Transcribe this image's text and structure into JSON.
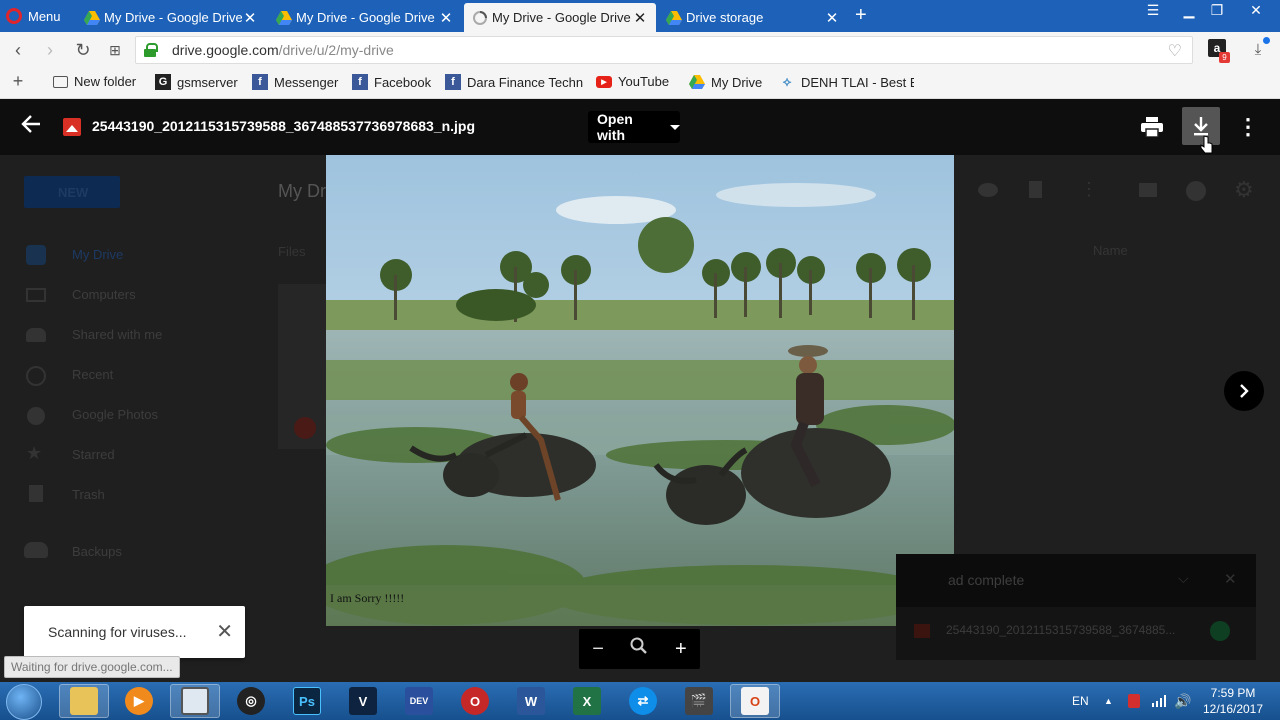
{
  "browser": {
    "menu_label": "Menu",
    "tabs": [
      {
        "title": "My Drive - Google Drive",
        "close": "✕"
      },
      {
        "title": "My Drive - Google Drive",
        "close": "✕"
      },
      {
        "title": "My Drive - Google Drive",
        "close": "✕"
      },
      {
        "title": "Drive storage",
        "close": "✕"
      }
    ],
    "new_tab": "+",
    "url_host": "drive.google.com",
    "url_path": "/drive/u/2/my-drive",
    "amazon_badge": "9",
    "bookmarks": [
      {
        "label": "New folder",
        "icon": "folder-icon"
      },
      {
        "label": "gsmserver",
        "icon": "g-icon"
      },
      {
        "label": "Messenger",
        "icon": "facebook-icon"
      },
      {
        "label": "Facebook",
        "icon": "facebook-icon"
      },
      {
        "label": "Dara Finance Techn",
        "icon": "facebook-icon"
      },
      {
        "label": "YouTube",
        "icon": "youtube-icon"
      },
      {
        "label": "My Drive",
        "icon": "drive-icon"
      },
      {
        "label": "DENH TLAI - Best Bi",
        "icon": "site-icon"
      }
    ]
  },
  "drive_background": {
    "new_button": "NEW",
    "page_title": "My Driv",
    "files_heading": "Files",
    "sort_label": "Name",
    "sidebar": [
      "My Drive",
      "Computers",
      "Shared with me",
      "Recent",
      "Google Photos",
      "Starred",
      "Trash",
      "Backups"
    ]
  },
  "viewer": {
    "file_name": "25443190_2012115315739588_367488537736978683_n.jpg",
    "open_with": "Open with",
    "photo_caption": "I am Sorry !!!!!",
    "zoom_out": "−",
    "zoom_in": "+"
  },
  "downloads_panel": {
    "title": "ad complete",
    "file": "25443190_2012115315739588_3674885..."
  },
  "toast": {
    "message": "Scanning for viruses...",
    "close": "✕"
  },
  "status_text": "Waiting for drive.google.com...",
  "taskbar": {
    "language": "EN",
    "time": "7:59 PM",
    "date": "12/16/2017"
  },
  "colors": {
    "tab_bar": "#1d62b8",
    "viewer_bg": "#1f1f1f",
    "secure_lock": "#2c9b2c",
    "drive_red": "#d93025"
  }
}
